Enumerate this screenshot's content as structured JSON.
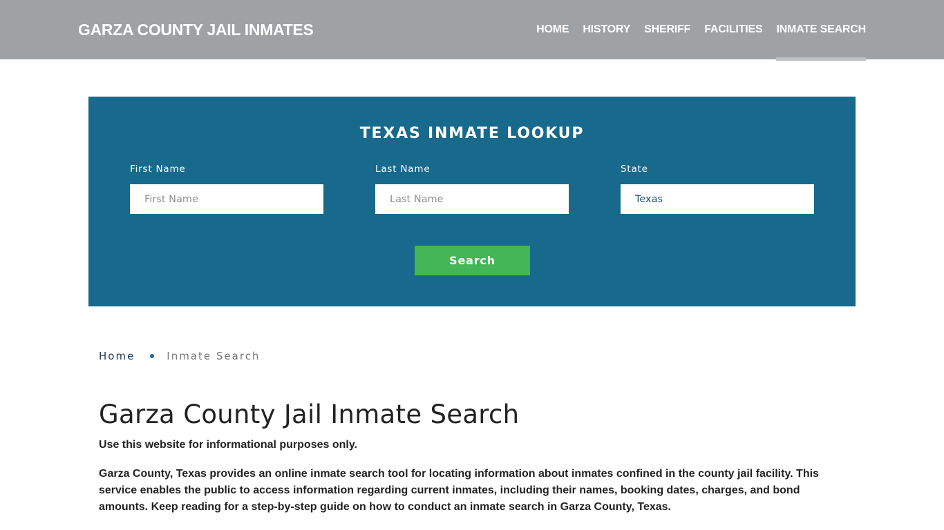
{
  "header": {
    "brand": "GARZA COUNTY JAIL INMATES",
    "nav": [
      {
        "label": "HOME",
        "active": false
      },
      {
        "label": "HISTORY",
        "active": false
      },
      {
        "label": "SHERIFF",
        "active": false
      },
      {
        "label": "FACILITIES",
        "active": false
      },
      {
        "label": "INMATE SEARCH",
        "active": true
      }
    ]
  },
  "lookup": {
    "title": "TEXAS INMATE LOOKUP",
    "fields": {
      "first_name": {
        "label": "First Name",
        "placeholder": "First Name",
        "value": ""
      },
      "last_name": {
        "label": "Last Name",
        "placeholder": "Last Name",
        "value": ""
      },
      "state": {
        "label": "State",
        "value": "Texas"
      }
    },
    "search_label": "Search"
  },
  "breadcrumb": {
    "home": "Home",
    "current": "Inmate Search"
  },
  "content": {
    "title": "Garza County Jail Inmate Search",
    "disclaimer": "Use this website for informational purposes only.",
    "intro": "Garza County, Texas provides an online inmate search tool for locating information about inmates confined in the county jail facility. This service enables the public to access information regarding current inmates, including their names, booking dates, charges, and bond amounts. Keep reading for a step-by-step guide on how to conduct an inmate search in Garza County, Texas."
  },
  "colors": {
    "header_bg": "#9ea2a5",
    "lookup_bg": "#186a8c",
    "search_button": "#45b658"
  }
}
